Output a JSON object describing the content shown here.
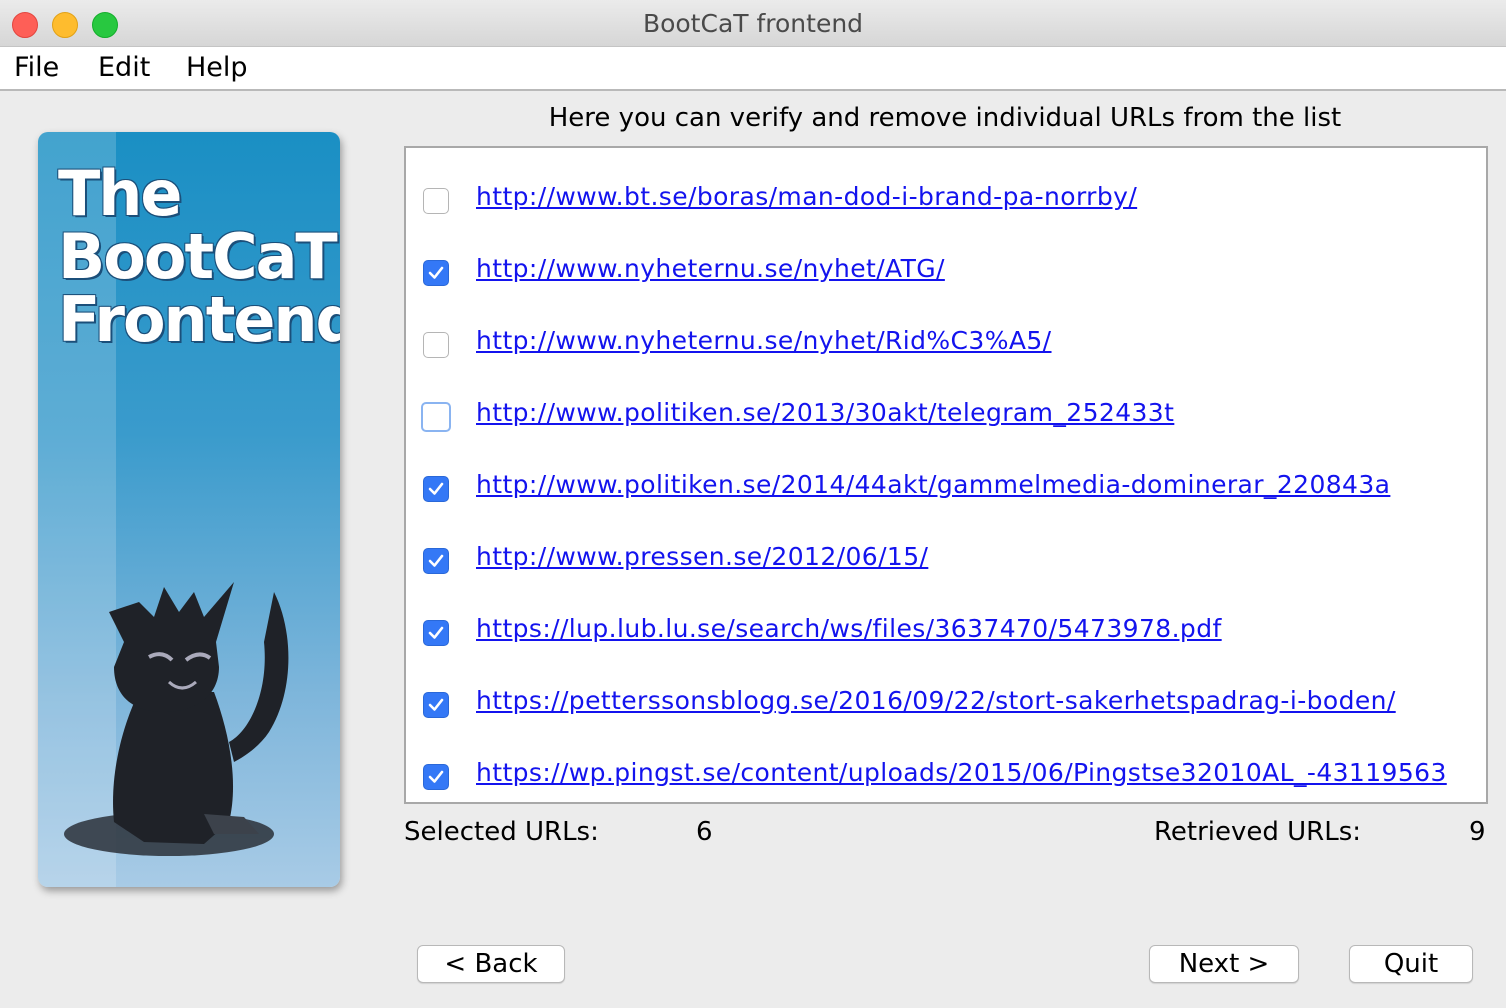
{
  "window": {
    "title": "BootCaT frontend"
  },
  "menu": {
    "file": "File",
    "edit": "Edit",
    "help": "Help"
  },
  "logo": {
    "line1": "The",
    "line2": "BootCaT",
    "line3": "Frontend"
  },
  "heading": "Here you can verify and remove individual URLs from the list",
  "urls": [
    {
      "url": "http://www.bt.se/boras/man-dod-i-brand-pa-norrby/",
      "checked": false
    },
    {
      "url": "http://www.nyheternu.se/nyhet/ATG/",
      "checked": true
    },
    {
      "url": "http://www.nyheternu.se/nyhet/Rid%C3%A5/",
      "checked": false
    },
    {
      "url": "http://www.politiken.se/2013/30akt/telegram_252433t",
      "checked": false
    },
    {
      "url": "http://www.politiken.se/2014/44akt/gammelmedia-dominerar_220843a",
      "checked": true
    },
    {
      "url": "http://www.pressen.se/2012/06/15/",
      "checked": true
    },
    {
      "url": "https://lup.lub.lu.se/search/ws/files/3637470/5473978.pdf",
      "checked": true
    },
    {
      "url": "https://petterssonsblogg.se/2016/09/22/stort-sakerhetspadrag-i-boden/",
      "checked": true
    },
    {
      "url": "https://wp.pingst.se/content/uploads/2015/06/Pingstse32010AL_-43119563",
      "checked": true
    }
  ],
  "counts": {
    "selected_label": "Selected URLs:",
    "selected_value": "6",
    "retrieved_label": "Retrieved URLs:",
    "retrieved_value": "9"
  },
  "buttons": {
    "back": "< Back",
    "next": "Next >",
    "quit": "Quit"
  },
  "colors": {
    "link": "#1313ee",
    "checkbox_checked": "#3478f6"
  }
}
